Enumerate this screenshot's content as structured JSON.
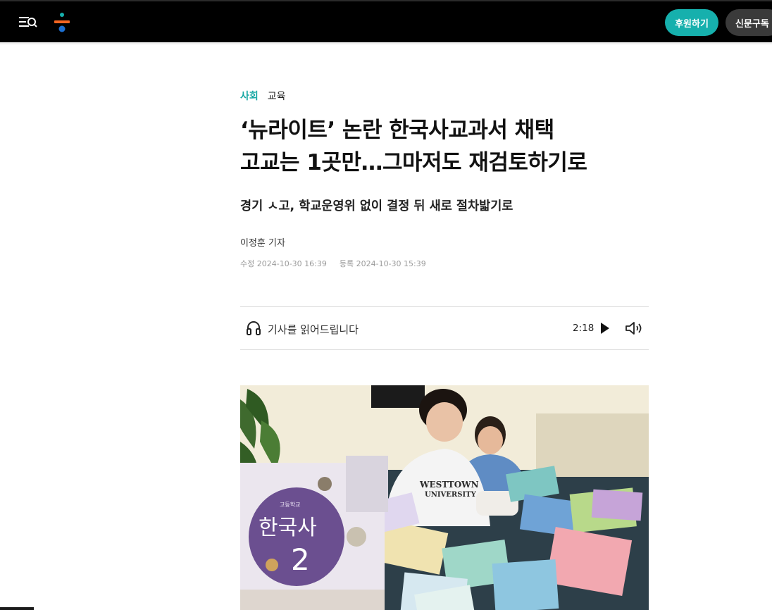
{
  "header": {
    "menu_icon": "menu-search-icon",
    "logo_icon": "division-sign-logo",
    "support_label": "후원하기",
    "subscribe_label": "신문구독",
    "colors": {
      "accent": "#16b0ad",
      "logo_orange": "#f26522",
      "logo_blue": "#1c6fd1"
    }
  },
  "article": {
    "section": "사회",
    "subsection": "교육",
    "headline_line1": "‘뉴라이트’ 논란 한국사교과서 채택",
    "headline_line2": "고교는 1곳만…그마저도 재검토하기로",
    "subheadline": "경기 ㅅ고, 학교운영위 없이 결정 뒤 새로 절차밟기로",
    "byline": "이정훈 기자",
    "modified": "수정 2024-10-30 16:39",
    "registered": "등록 2024-10-30 15:39"
  },
  "audio": {
    "label": "기사를 읽어드립니다",
    "duration": "2:18",
    "play_icon": "play-icon",
    "volume_icon": "volume-icon",
    "headphone_icon": "headphone-icon"
  },
  "photo": {
    "book_series": "고등학교",
    "book_title": "한국사",
    "book_number": "2"
  }
}
